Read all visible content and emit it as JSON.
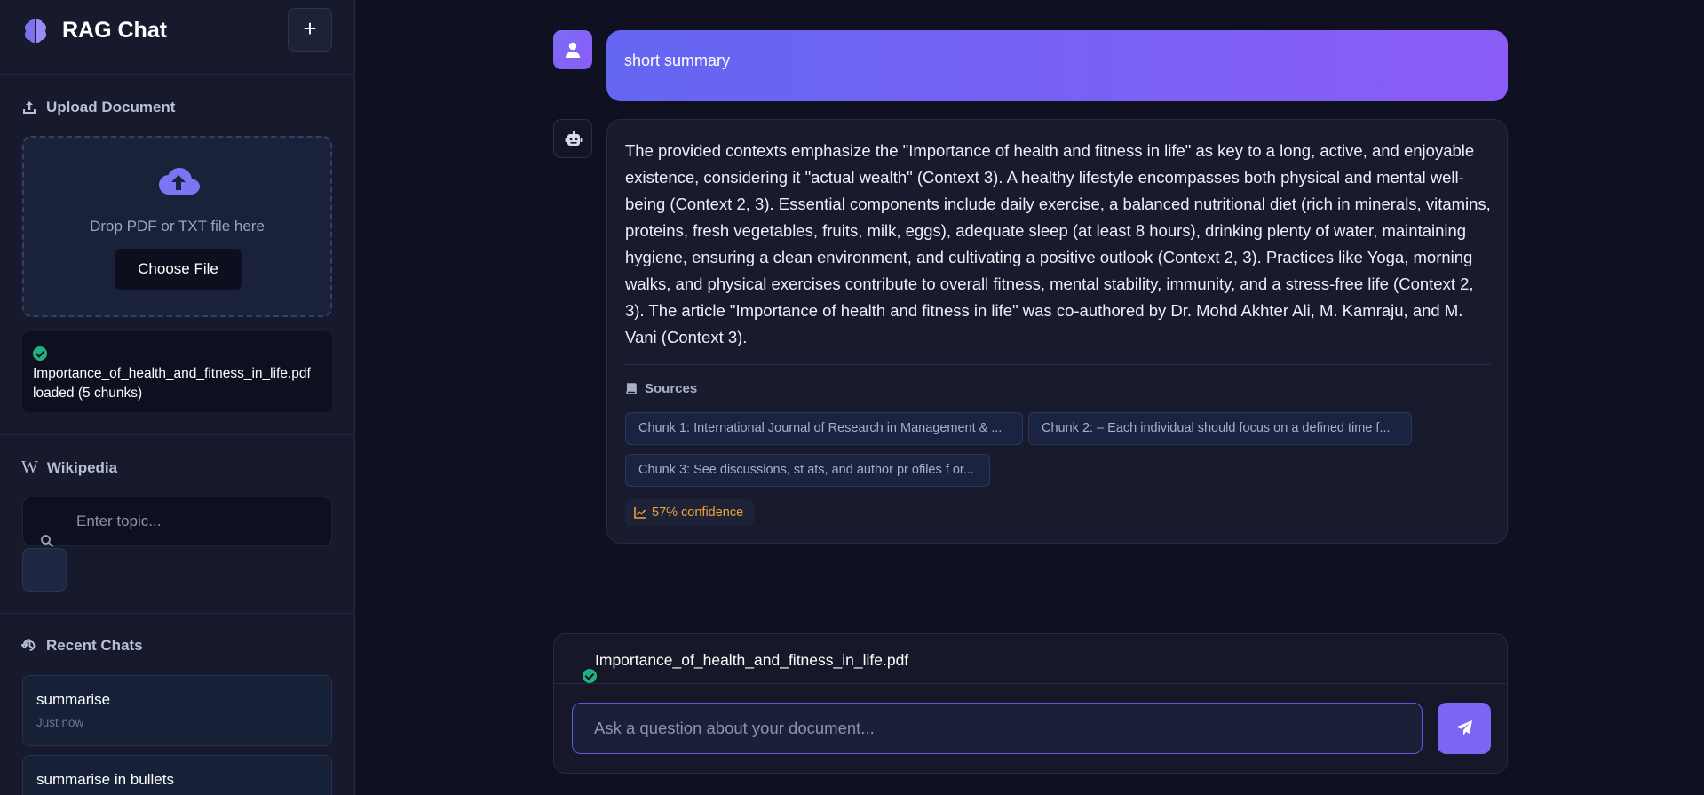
{
  "app": {
    "title": "RAG Chat",
    "new_chat_label": "+"
  },
  "upload": {
    "section_title": "Upload Document",
    "drop_text": "Drop PDF or TXT file here",
    "choose_label": "Choose File",
    "status_file": "Importance_of_health_and_fitness_in_life.pdf",
    "status_suffix": "loaded (5 chunks)"
  },
  "wikipedia": {
    "glyph": "W",
    "section_title": "Wikipedia",
    "placeholder": "Enter topic..."
  },
  "recent": {
    "section_title": "Recent Chats",
    "items": [
      {
        "title": "summarise",
        "time": "Just now"
      },
      {
        "title": "summarise in bullets",
        "time": ""
      }
    ]
  },
  "conversation": {
    "user_message": "short summary",
    "bot_message": "The provided contexts emphasize the \"Importance of health and fitness in life\" as key to a long, active, and enjoyable existence, considering it \"actual wealth\" (Context 3). A healthy lifestyle encompasses both physical and mental well-being (Context 2, 3). Essential components include daily exercise, a balanced nutritional diet (rich in minerals, vitamins, proteins, fresh vegetables, fruits, milk, eggs), adequate sleep (at least 8 hours), drinking plenty of water, maintaining hygiene, ensuring a clean environment, and cultivating a positive outlook (Context 2, 3). Practices like Yoga, morning walks, and physical exercises contribute to overall fitness, mental stability, immunity, and a stress-free life (Context 2, 3). The article \"Importance of health and fitness in life\" was co-authored by Dr. Mohd Akhter Ali, M. Kamraju, and M. Vani (Context 3).",
    "sources_title": "Sources",
    "sources": [
      "Chunk 1: International Journal of Research in Management & ...",
      "Chunk 2: – Each individual should focus on a defined time f...",
      "Chunk 3: See discussions, st ats, and author pr ofiles f or..."
    ],
    "confidence": "57% confidence"
  },
  "composer": {
    "attached_file": "Importance_of_health_and_fitness_in_life.pdf",
    "placeholder": "Ask a question about your document..."
  },
  "colors": {
    "accent": "#6366f1",
    "accent_2": "#8b5cf6",
    "success": "#22b07d",
    "confidence": "#f0a23c",
    "background": "#0f1021",
    "sidebar": "#171a2c"
  },
  "icons": {
    "brand": "brain-icon",
    "upload": "upload-icon",
    "cloud": "cloud-upload-icon",
    "search": "search-icon",
    "history": "history-icon",
    "user": "user-icon",
    "bot": "robot-icon",
    "book": "book-icon",
    "chart": "chart-line-icon",
    "send": "paper-plane-icon",
    "check": "check-circle-icon"
  }
}
